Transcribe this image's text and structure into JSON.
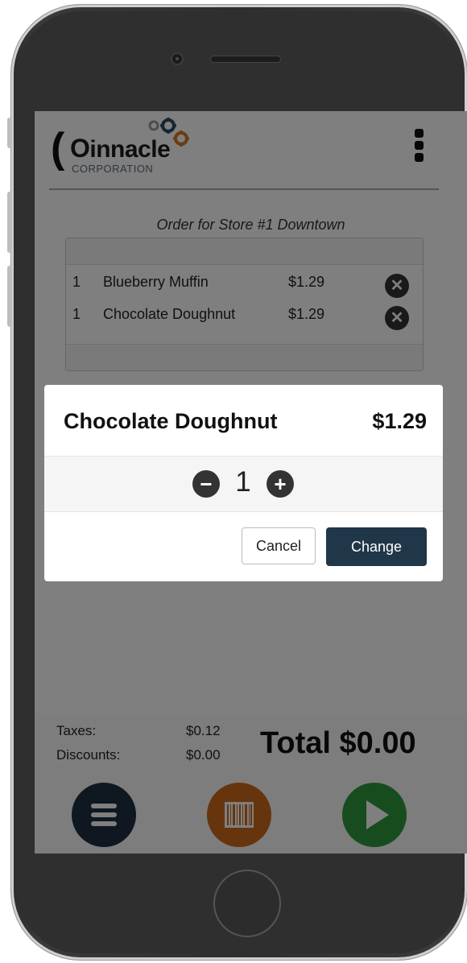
{
  "app": {
    "logo_word": "innacle",
    "logo_sub": "CORPORATION"
  },
  "order": {
    "title": "Order for Store #1 Downtown",
    "items": [
      {
        "qty": "1",
        "name": "Blueberry Muffin",
        "price": "$1.29"
      },
      {
        "qty": "1",
        "name": "Chocolate Doughnut",
        "price": "$1.29"
      }
    ]
  },
  "summary": {
    "taxes_label": "Taxes:",
    "taxes_value": "$0.12",
    "discounts_label": "Discounts:",
    "discounts_value": "$0.00",
    "total": "Total $0.00"
  },
  "modal": {
    "item_name": "Chocolate Doughnut",
    "item_price": "$1.29",
    "quantity": "1",
    "cancel_label": "Cancel",
    "change_label": "Change"
  },
  "icons": {
    "remove": "close-circle-icon",
    "menu": "menu-icon",
    "barcode": "barcode-icon",
    "play": "play-icon",
    "minus": "minus-circle-icon",
    "plus": "plus-circle-icon",
    "more": "more-vertical-icon"
  },
  "colors": {
    "primary": "#203649",
    "barcode_button": "#cc6a1c",
    "play_button": "#2f9a3c",
    "menu_button": "#1f3142",
    "gear_orange": "#d9781c",
    "gear_blue": "#2d4a66"
  }
}
